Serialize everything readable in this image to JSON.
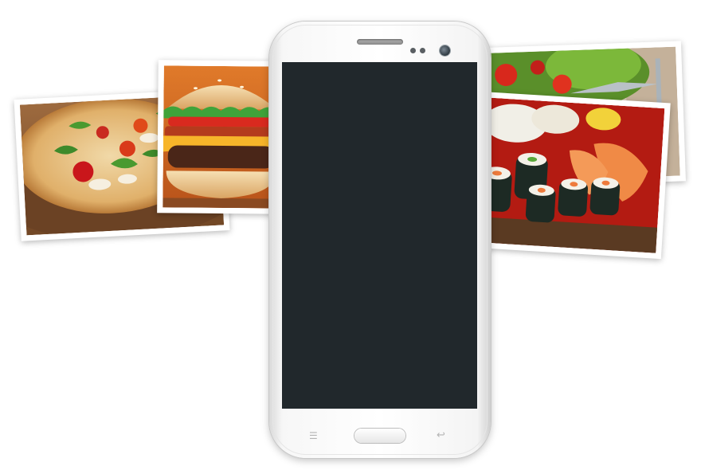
{
  "scene": {
    "background_color": "#ffffff",
    "photos": [
      {
        "id": "pizza",
        "icon": "pizza-photo"
      },
      {
        "id": "burger",
        "icon": "burger-photo"
      },
      {
        "id": "salad",
        "icon": "salad-photo"
      },
      {
        "id": "sushi",
        "icon": "sushi-photo"
      }
    ],
    "phone": {
      "screen_color": "#21282c",
      "body_color": "#f5f5f5",
      "menu_glyph": "☰",
      "back_glyph": "↩"
    }
  }
}
